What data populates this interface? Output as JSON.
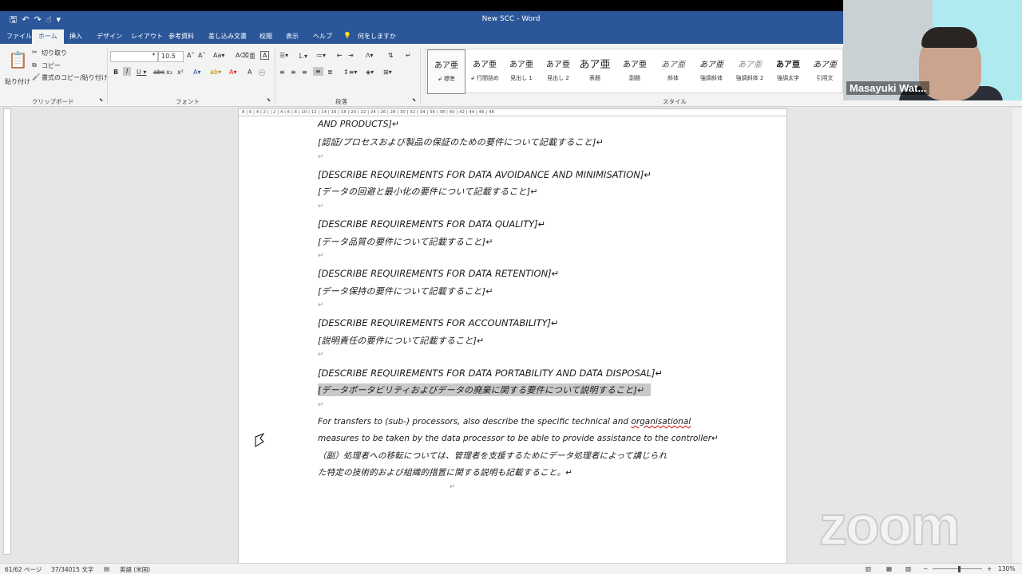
{
  "title": {
    "doc": "New SCC  -  Word"
  },
  "menu": {
    "tabs": [
      "ファイル",
      "ホーム",
      "挿入",
      "デザイン",
      "レイアウト",
      "参考資料",
      "差し込み文書",
      "校閲",
      "表示",
      "ヘルプ",
      "何をしますか"
    ],
    "active_tab": "ホーム"
  },
  "ribbon": {
    "clipboard": {
      "paste": "貼り付け",
      "cut": "切り取り",
      "copy": "コピー",
      "format_painter": "書式のコピー/貼り付け",
      "label": "クリップボード"
    },
    "font": {
      "size": "10.5",
      "label": "フォント"
    },
    "paragraph": {
      "label": "段落"
    },
    "styles": {
      "label": "スタイル",
      "items": [
        {
          "sample": "あア亜",
          "name": "↲ 標準"
        },
        {
          "sample": "あア亜",
          "name": "↲ 行間詰め"
        },
        {
          "sample": "あア亜",
          "name": "見出し 1"
        },
        {
          "sample": "あア亜",
          "name": "見出し 2"
        },
        {
          "sample": "あア亜",
          "name": "表題"
        },
        {
          "sample": "あア亜",
          "name": "副題"
        },
        {
          "sample": "あア亜",
          "name": "斜体"
        },
        {
          "sample": "あア亜",
          "name": "強調斜体"
        },
        {
          "sample": "あア亜",
          "name": "強調斜体 2"
        },
        {
          "sample": "あア亜",
          "name": "強調太字"
        },
        {
          "sample": "あア亜",
          "name": "引用文"
        }
      ]
    }
  },
  "ruler": {
    "ticks": "8  |  6  |  4  |  2  |     |  2  |  4  |  6  |  8  |  10  |  12  |  14  |  16  |  18  |  20  |  22  |  24  |  26  |  28  |  30  |  32  |  34  |  36  |  38  |  40  |  42  |  44  |  46  |  48"
  },
  "document": {
    "lines": [
      "AND PRODUCTS]↵",
      "[認証/プロセスおよび製品の保証のための要件について記載すること]↵",
      "↵",
      "[DESCRIBE REQUIREMENTS FOR DATA AVOIDANCE AND MINIMISATION]↵",
      "[データの回避と最小化の要件について記載すること]↵",
      "↵",
      "[DESCRIBE REQUIREMENTS FOR DATA QUALITY]↵",
      "[データ品質の要件について記載すること]↵",
      "↵",
      "[DESCRIBE REQUIREMENTS FOR DATA RETENTION]↵",
      "[データ保持の要件について記載すること]↵",
      "↵",
      "[DESCRIBE REQUIREMENTS FOR ACCOUNTABILITY]↵",
      "[説明責任の要件について記載すること]↵",
      "↵",
      "[DESCRIBE REQUIREMENTS FOR DATA PORTABILITY AND DATA DISPOSAL]↵",
      "[データポータビリティおよびデータの廃棄に関する要件について説明すること]↵",
      "↵"
    ],
    "para_en_1a": "For transfers to (sub-) processors, also describe the specific technical and ",
    "para_en_1b": "organisational",
    "para_en_2": "measures to be taken by the data processor to be able to provide assistance to the controller↵",
    "para_jp_1": "（副）処理者への移転については、管理者を支援するためにデータ処理者によって講じられ",
    "para_jp_2": "た特定の技術的および組織的措置に関する説明も記載すること。↵",
    "trailing_mark": "↵"
  },
  "status": {
    "page": "61/62 ページ",
    "words": "37/34015 文字",
    "language": "英語 (米国)",
    "zoom": "130%"
  },
  "zoom_call": {
    "participant": "Masayuki Wat...",
    "logo": "zoom"
  }
}
